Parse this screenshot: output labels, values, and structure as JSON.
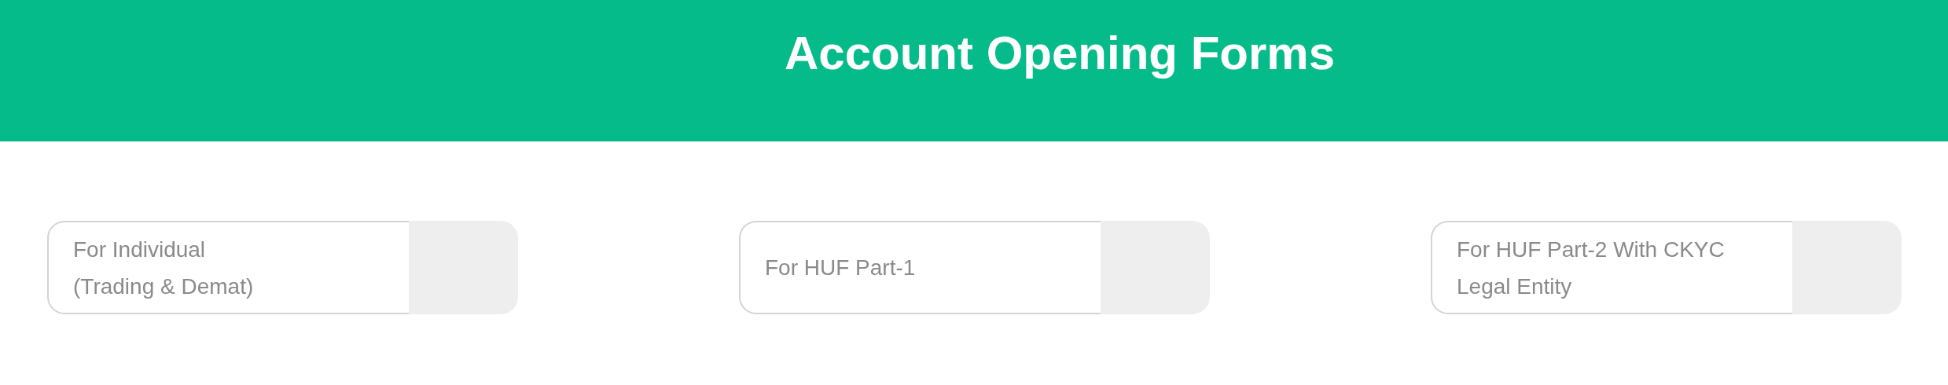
{
  "header": {
    "title": "Account Opening Forms"
  },
  "forms": [
    {
      "label": "For Individual\n(Trading & Demat)"
    },
    {
      "label": "For HUF Part-1"
    },
    {
      "label": "For HUF Part-2 With CKYC\nLegal Entity"
    }
  ]
}
